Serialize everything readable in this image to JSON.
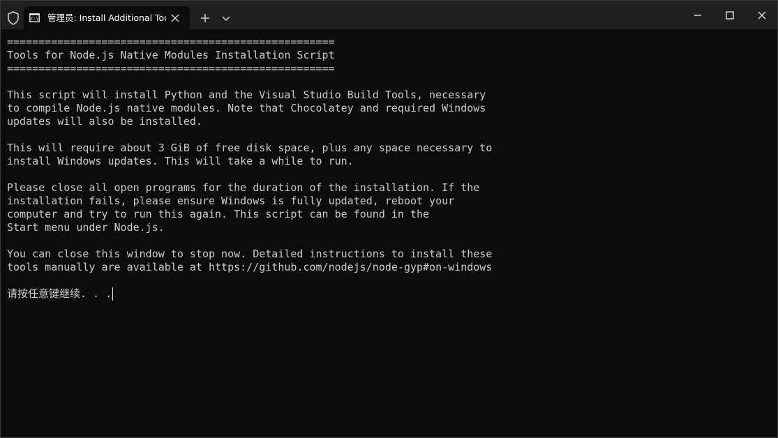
{
  "titlebar": {
    "tab_title": "管理员:  Install Additional Too",
    "shield_icon": "shield-icon",
    "tab_icon": "cmd-icon",
    "close_tab_icon": "close-icon",
    "new_tab_icon": "plus-icon",
    "dropdown_icon": "chevron-down-icon",
    "window_controls": [
      "minimize-icon",
      "maximize-icon",
      "close-icon"
    ]
  },
  "terminal": {
    "lines": [
      "====================================================",
      "Tools for Node.js Native Modules Installation Script",
      "====================================================",
      "",
      "This script will install Python and the Visual Studio Build Tools, necessary",
      "to compile Node.js native modules. Note that Chocolatey and required Windows",
      "updates will also be installed.",
      "",
      "This will require about 3 GiB of free disk space, plus any space necessary to",
      "install Windows updates. This will take a while to run.",
      "",
      "Please close all open programs for the duration of the installation. If the",
      "installation fails, please ensure Windows is fully updated, reboot your",
      "computer and try to run this again. This script can be found in the",
      "Start menu under Node.js.",
      "",
      "You can close this window to stop now. Detailed instructions to install these",
      "tools manually are available at https://github.com/nodejs/node-gyp#on-windows",
      ""
    ],
    "prompt": "请按任意键继续. . ."
  },
  "colors": {
    "background": "#0c0c0c",
    "titlebar": "#1f1f1f",
    "text": "#cccccc"
  }
}
